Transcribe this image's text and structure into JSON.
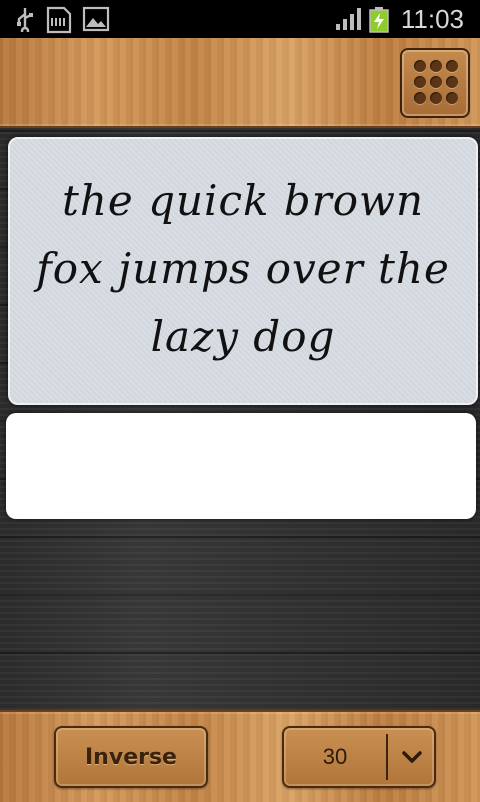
{
  "status_bar": {
    "time": "11:03",
    "icons": [
      "usb-icon",
      "sd-card-icon",
      "image-icon",
      "signal-icon",
      "battery-charging-icon"
    ]
  },
  "toolbar": {
    "menu_icon": "grid-menu-icon"
  },
  "preview": {
    "text": "the quick brown fox jumps over the lazy dog"
  },
  "input": {
    "value": ""
  },
  "bottom": {
    "inverse_label": "Inverse",
    "size_value": "30",
    "dropdown_icon": "chevron-down-icon"
  },
  "colors": {
    "wood": "#c98f53",
    "dark_wood": "#333333",
    "preview_bg": "#d6dbe2"
  }
}
